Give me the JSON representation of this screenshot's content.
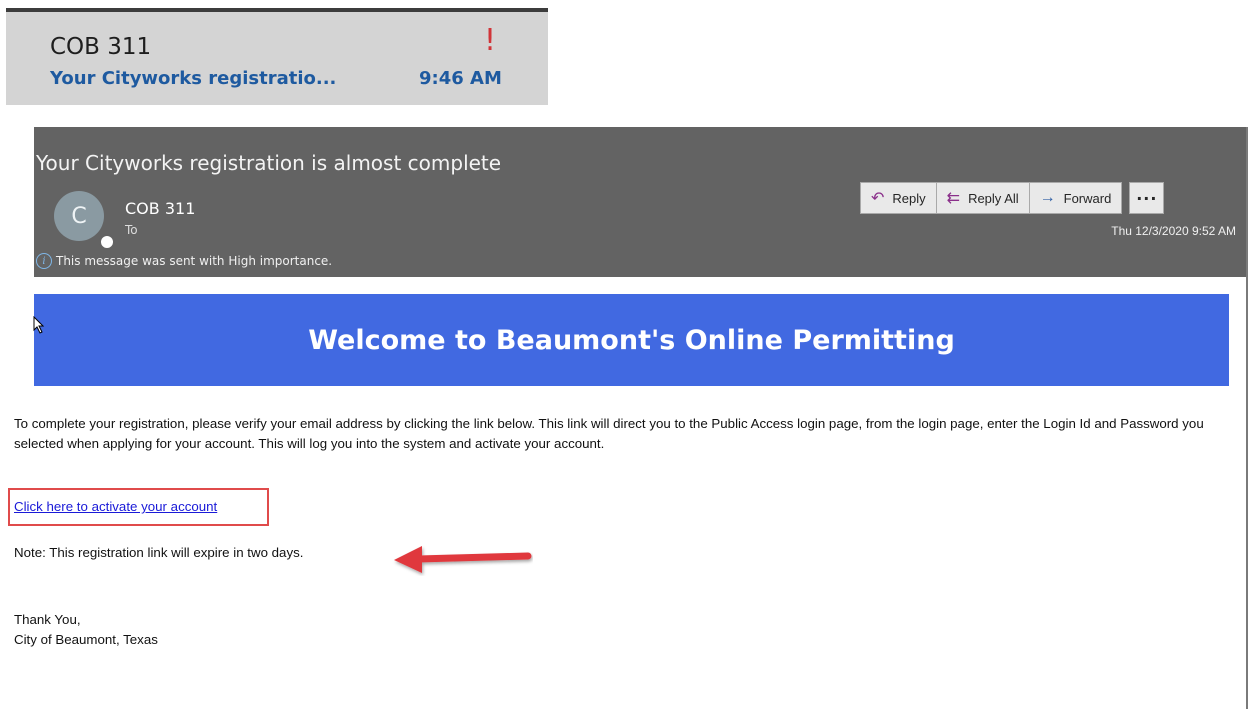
{
  "inbox_preview": {
    "sender": "COB 311",
    "importance_mark": "!",
    "subject": "Your Cityworks registratio...",
    "time": "9:46 AM"
  },
  "message_header": {
    "subject": "Your Cityworks registration is almost complete",
    "avatar_initial": "C",
    "from": "COB 311",
    "to_label": "To",
    "importance_notice": "This message was sent with High importance.",
    "actions": {
      "reply": "Reply",
      "reply_all": "Reply All",
      "forward": "Forward",
      "more": "···"
    },
    "sent_date": "Thu 12/3/2020 9:52 AM"
  },
  "body": {
    "banner_title": "Welcome to Beaumont's Online Permitting",
    "intro": "To complete your registration, please verify your email address by clicking the link below. This link will direct you to the Public Access login page, from the login page, enter the Login Id and Password you selected when applying for your account. This will log you into the system and activate your account.",
    "activate_link": "Click here to activate your account",
    "note": "Note: This registration link will expire in two days.",
    "signoff_line1": "Thank You,",
    "signoff_line2": "City of Beaumont, Texas"
  },
  "colors": {
    "banner": "#4169e1",
    "importance": "#d13438",
    "annotation": "#e04b4b",
    "link": "#1a1ad8"
  },
  "icons": {
    "reply": "reply-arrow-icon",
    "reply_all": "reply-all-icon",
    "forward": "forward-arrow-icon",
    "info": "info-icon",
    "cursor": "mouse-cursor-icon",
    "annotation": "red-arrow-icon"
  }
}
